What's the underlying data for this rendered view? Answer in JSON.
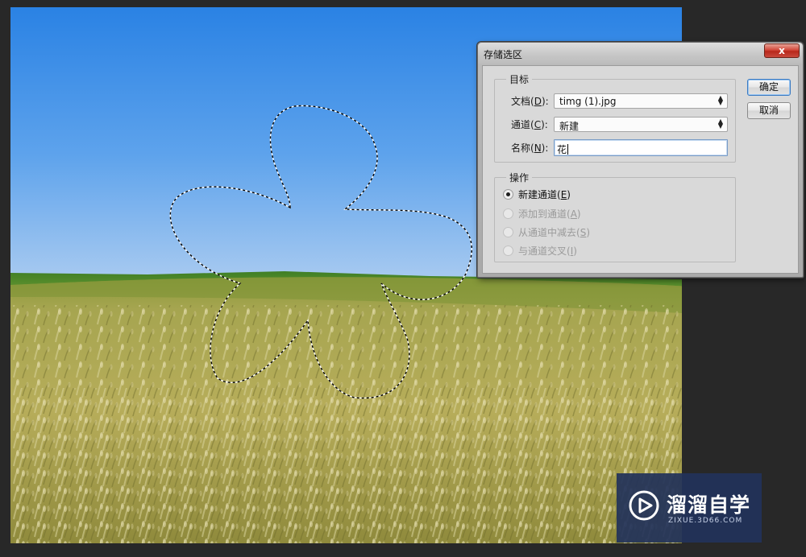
{
  "dialog": {
    "title": "存储选区",
    "close_label": "x",
    "target_group": "目标",
    "document": {
      "label_prefix": "文档(",
      "label_key": "D",
      "label_suffix": "):",
      "value": "timg (1).jpg"
    },
    "channel": {
      "label_prefix": "通道(",
      "label_key": "C",
      "label_suffix": "):",
      "value": "新建"
    },
    "name": {
      "label_prefix": "名称(",
      "label_key": "N",
      "label_suffix": "):",
      "value": "花"
    },
    "operation_group": "操作",
    "operations": [
      {
        "text": "新建通道(",
        "key": "E",
        "end": ")",
        "checked": true,
        "enabled": true
      },
      {
        "text": "添加到通道(",
        "key": "A",
        "end": ")",
        "checked": false,
        "enabled": false
      },
      {
        "text": "从通道中减去(",
        "key": "S",
        "end": ")",
        "checked": false,
        "enabled": false
      },
      {
        "text": "与通道交叉(",
        "key": "I",
        "end": ")",
        "checked": false,
        "enabled": false
      }
    ],
    "ok_label": "确定",
    "cancel_label": "取消"
  },
  "watermark": {
    "title": "溜溜自学",
    "subtitle": "ZIXUE.3D66.COM"
  },
  "colors": {
    "sky_top": "#2f86e6",
    "sky_bottom": "#9ec6f0",
    "field": "#a9a446",
    "dark_bg": "#282828"
  }
}
